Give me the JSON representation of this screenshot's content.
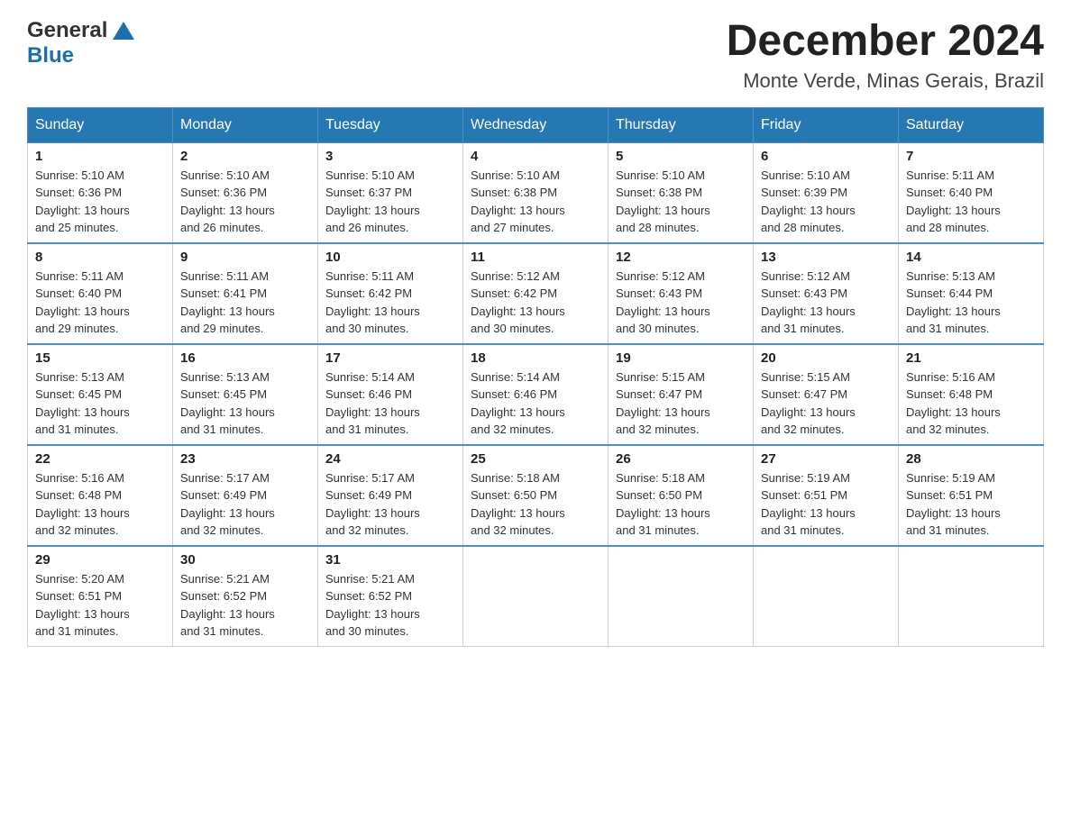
{
  "header": {
    "logo_general": "General",
    "logo_blue": "Blue",
    "title": "December 2024",
    "subtitle": "Monte Verde, Minas Gerais, Brazil"
  },
  "calendar": {
    "days_of_week": [
      "Sunday",
      "Monday",
      "Tuesday",
      "Wednesday",
      "Thursday",
      "Friday",
      "Saturday"
    ],
    "weeks": [
      [
        {
          "date": "1",
          "sunrise": "5:10 AM",
          "sunset": "6:36 PM",
          "daylight": "13 hours and 25 minutes."
        },
        {
          "date": "2",
          "sunrise": "5:10 AM",
          "sunset": "6:36 PM",
          "daylight": "13 hours and 26 minutes."
        },
        {
          "date": "3",
          "sunrise": "5:10 AM",
          "sunset": "6:37 PM",
          "daylight": "13 hours and 26 minutes."
        },
        {
          "date": "4",
          "sunrise": "5:10 AM",
          "sunset": "6:38 PM",
          "daylight": "13 hours and 27 minutes."
        },
        {
          "date": "5",
          "sunrise": "5:10 AM",
          "sunset": "6:38 PM",
          "daylight": "13 hours and 28 minutes."
        },
        {
          "date": "6",
          "sunrise": "5:10 AM",
          "sunset": "6:39 PM",
          "daylight": "13 hours and 28 minutes."
        },
        {
          "date": "7",
          "sunrise": "5:11 AM",
          "sunset": "6:40 PM",
          "daylight": "13 hours and 28 minutes."
        }
      ],
      [
        {
          "date": "8",
          "sunrise": "5:11 AM",
          "sunset": "6:40 PM",
          "daylight": "13 hours and 29 minutes."
        },
        {
          "date": "9",
          "sunrise": "5:11 AM",
          "sunset": "6:41 PM",
          "daylight": "13 hours and 29 minutes."
        },
        {
          "date": "10",
          "sunrise": "5:11 AM",
          "sunset": "6:42 PM",
          "daylight": "13 hours and 30 minutes."
        },
        {
          "date": "11",
          "sunrise": "5:12 AM",
          "sunset": "6:42 PM",
          "daylight": "13 hours and 30 minutes."
        },
        {
          "date": "12",
          "sunrise": "5:12 AM",
          "sunset": "6:43 PM",
          "daylight": "13 hours and 30 minutes."
        },
        {
          "date": "13",
          "sunrise": "5:12 AM",
          "sunset": "6:43 PM",
          "daylight": "13 hours and 31 minutes."
        },
        {
          "date": "14",
          "sunrise": "5:13 AM",
          "sunset": "6:44 PM",
          "daylight": "13 hours and 31 minutes."
        }
      ],
      [
        {
          "date": "15",
          "sunrise": "5:13 AM",
          "sunset": "6:45 PM",
          "daylight": "13 hours and 31 minutes."
        },
        {
          "date": "16",
          "sunrise": "5:13 AM",
          "sunset": "6:45 PM",
          "daylight": "13 hours and 31 minutes."
        },
        {
          "date": "17",
          "sunrise": "5:14 AM",
          "sunset": "6:46 PM",
          "daylight": "13 hours and 31 minutes."
        },
        {
          "date": "18",
          "sunrise": "5:14 AM",
          "sunset": "6:46 PM",
          "daylight": "13 hours and 32 minutes."
        },
        {
          "date": "19",
          "sunrise": "5:15 AM",
          "sunset": "6:47 PM",
          "daylight": "13 hours and 32 minutes."
        },
        {
          "date": "20",
          "sunrise": "5:15 AM",
          "sunset": "6:47 PM",
          "daylight": "13 hours and 32 minutes."
        },
        {
          "date": "21",
          "sunrise": "5:16 AM",
          "sunset": "6:48 PM",
          "daylight": "13 hours and 32 minutes."
        }
      ],
      [
        {
          "date": "22",
          "sunrise": "5:16 AM",
          "sunset": "6:48 PM",
          "daylight": "13 hours and 32 minutes."
        },
        {
          "date": "23",
          "sunrise": "5:17 AM",
          "sunset": "6:49 PM",
          "daylight": "13 hours and 32 minutes."
        },
        {
          "date": "24",
          "sunrise": "5:17 AM",
          "sunset": "6:49 PM",
          "daylight": "13 hours and 32 minutes."
        },
        {
          "date": "25",
          "sunrise": "5:18 AM",
          "sunset": "6:50 PM",
          "daylight": "13 hours and 32 minutes."
        },
        {
          "date": "26",
          "sunrise": "5:18 AM",
          "sunset": "6:50 PM",
          "daylight": "13 hours and 31 minutes."
        },
        {
          "date": "27",
          "sunrise": "5:19 AM",
          "sunset": "6:51 PM",
          "daylight": "13 hours and 31 minutes."
        },
        {
          "date": "28",
          "sunrise": "5:19 AM",
          "sunset": "6:51 PM",
          "daylight": "13 hours and 31 minutes."
        }
      ],
      [
        {
          "date": "29",
          "sunrise": "5:20 AM",
          "sunset": "6:51 PM",
          "daylight": "13 hours and 31 minutes."
        },
        {
          "date": "30",
          "sunrise": "5:21 AM",
          "sunset": "6:52 PM",
          "daylight": "13 hours and 31 minutes."
        },
        {
          "date": "31",
          "sunrise": "5:21 AM",
          "sunset": "6:52 PM",
          "daylight": "13 hours and 30 minutes."
        },
        null,
        null,
        null,
        null
      ]
    ],
    "labels": {
      "sunrise": "Sunrise:",
      "sunset": "Sunset:",
      "daylight": "Daylight:"
    }
  }
}
